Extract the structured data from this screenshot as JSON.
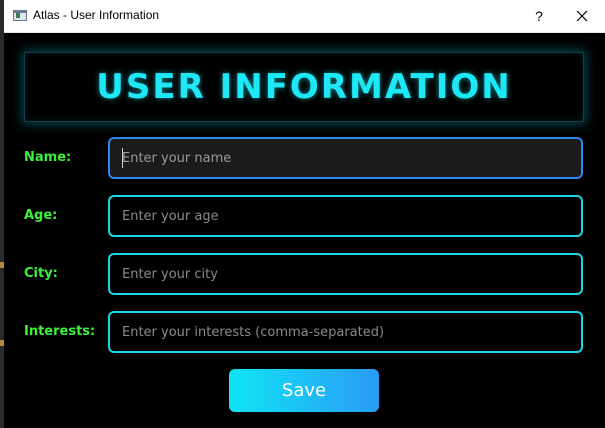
{
  "window": {
    "title": "Atlas - User Information",
    "help_glyph": "?"
  },
  "header": {
    "title": "USER INFORMATION"
  },
  "form": {
    "name_label": "Name:",
    "name_placeholder": "Enter your name",
    "age_label": "Age:",
    "age_placeholder": "Enter your age",
    "city_label": "City:",
    "city_placeholder": "Enter your city",
    "interests_label": "Interests:",
    "interests_placeholder": "Enter your interests (comma-separated)"
  },
  "actions": {
    "save_label": "Save"
  },
  "colors": {
    "accent_cyan": "#19d8e6",
    "label_green": "#3cf03c",
    "focus_blue": "#2e86f0",
    "button_gradient_start": "#10e4f4",
    "button_gradient_end": "#2a9bf6"
  },
  "icons": {
    "app": "app-window-icon",
    "help": "help-icon",
    "close": "close-icon"
  }
}
